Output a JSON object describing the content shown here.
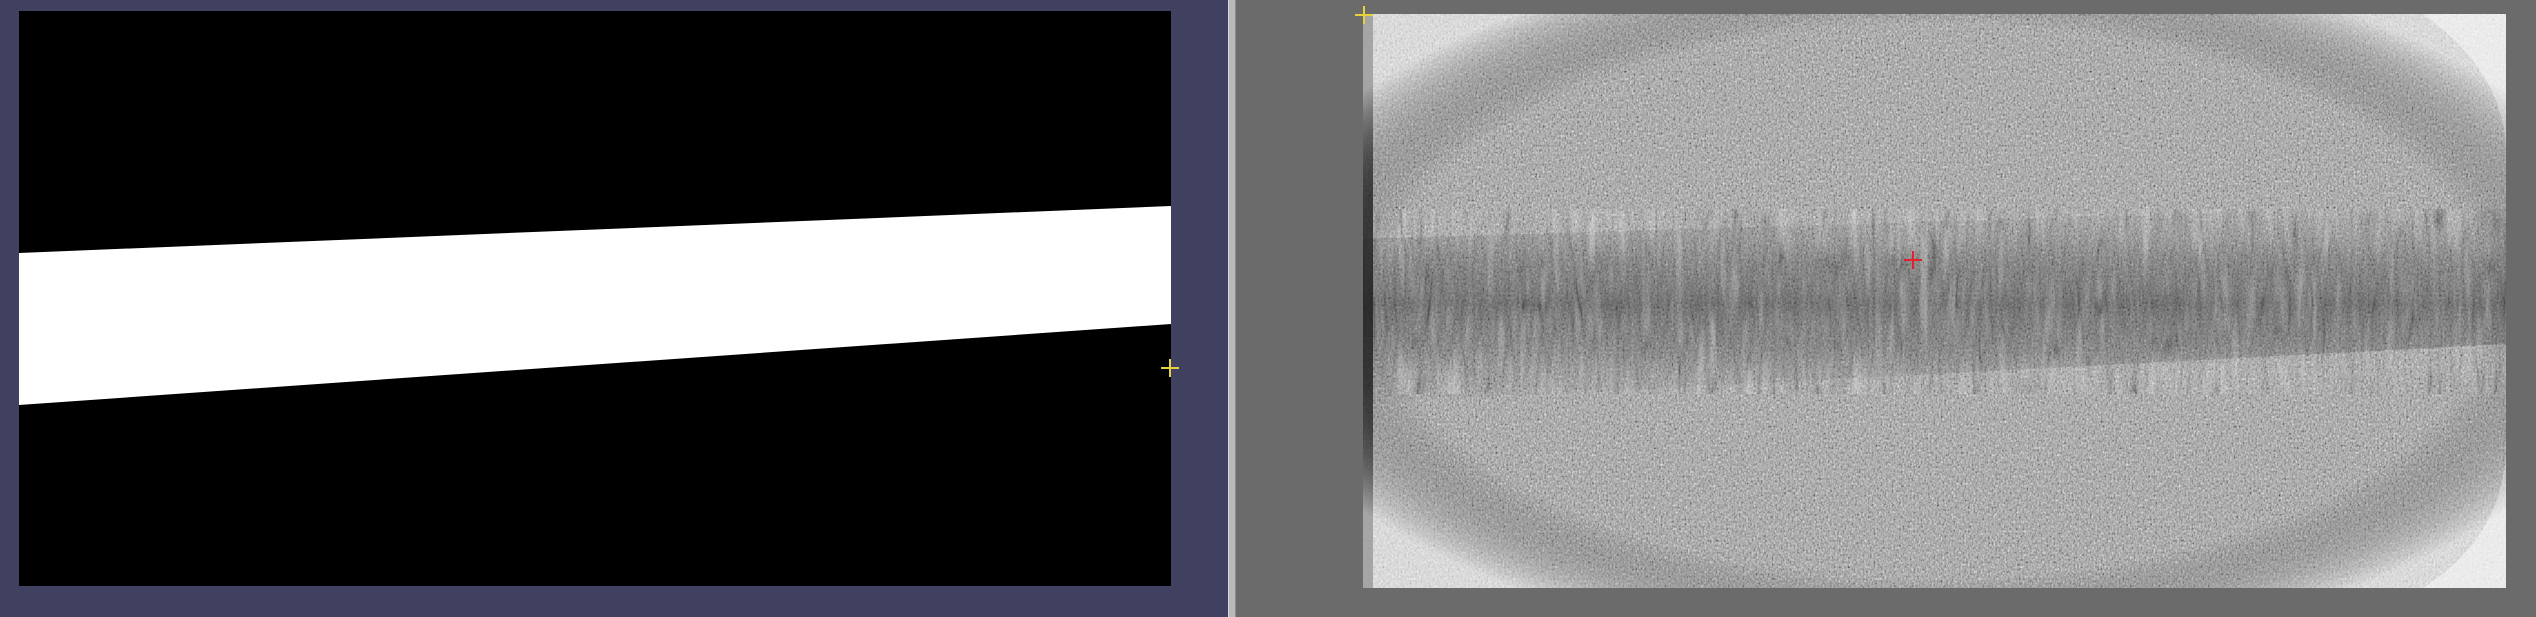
{
  "app": {
    "panels": [
      {
        "name": "segmentation-mask-view"
      },
      {
        "name": "tomogram-slice-view"
      }
    ]
  },
  "colors": {
    "left_background": "#404061",
    "right_background": "#6b6b6b",
    "mask_background": "#000000",
    "mask_foreground": "#ffffff",
    "marker_yellow": "#e8d23a",
    "marker_red": "#e0202e"
  },
  "icons": {
    "left_marker": "crosshair-icon",
    "right_corner_marker": "crosshair-icon",
    "right_center_marker": "crosshair-icon"
  }
}
